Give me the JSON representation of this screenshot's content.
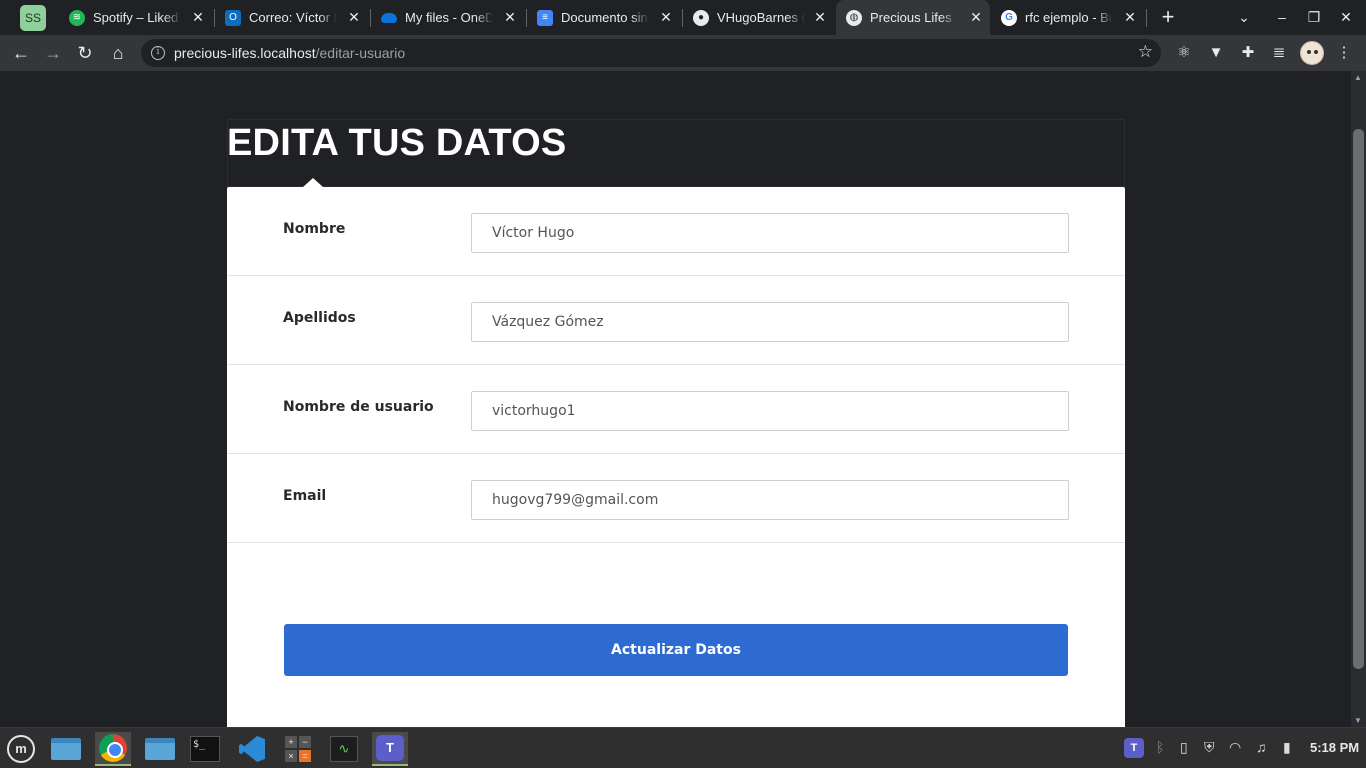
{
  "browser": {
    "profile_badge": "SS",
    "tabs": [
      {
        "title": "Spotify – Liked Songs",
        "favicon": "spotify-icon",
        "color": "#1db954"
      },
      {
        "title": "Correo: Víctor Hugo",
        "favicon": "outlook-icon",
        "color": "#0f6cbd"
      },
      {
        "title": "My files - OneDrive",
        "favicon": "onedrive-icon",
        "color": "#0a74da"
      },
      {
        "title": "Documento sin título",
        "favicon": "docs-icon",
        "color": "#4285f4"
      },
      {
        "title": "VHugoBarnes (Víctor)",
        "favicon": "github-icon",
        "color": "#202124"
      },
      {
        "title": "Precious Lifes",
        "favicon": "globe-icon",
        "color": "#e8eaed",
        "active": true
      },
      {
        "title": "rfc ejemplo - Buscar",
        "favicon": "google-icon",
        "color": "#4285f4"
      }
    ],
    "address_bar": {
      "host": "precious-lifes.localhost",
      "path": "/editar-usuario"
    }
  },
  "page": {
    "title": "EDITA TUS DATOS",
    "fields": [
      {
        "label": "Nombre",
        "value": "Víctor Hugo"
      },
      {
        "label": "Apellidos",
        "value": "Vázquez Gómez"
      },
      {
        "label": "Nombre de usuario",
        "value": "victorhugo1"
      },
      {
        "label": "Email",
        "value": "hugovg799@gmail.com"
      }
    ],
    "submit_label": "Actualizar Datos",
    "accent_color": "#2e6bd1"
  },
  "taskbar": {
    "clock": "5:18 PM"
  }
}
